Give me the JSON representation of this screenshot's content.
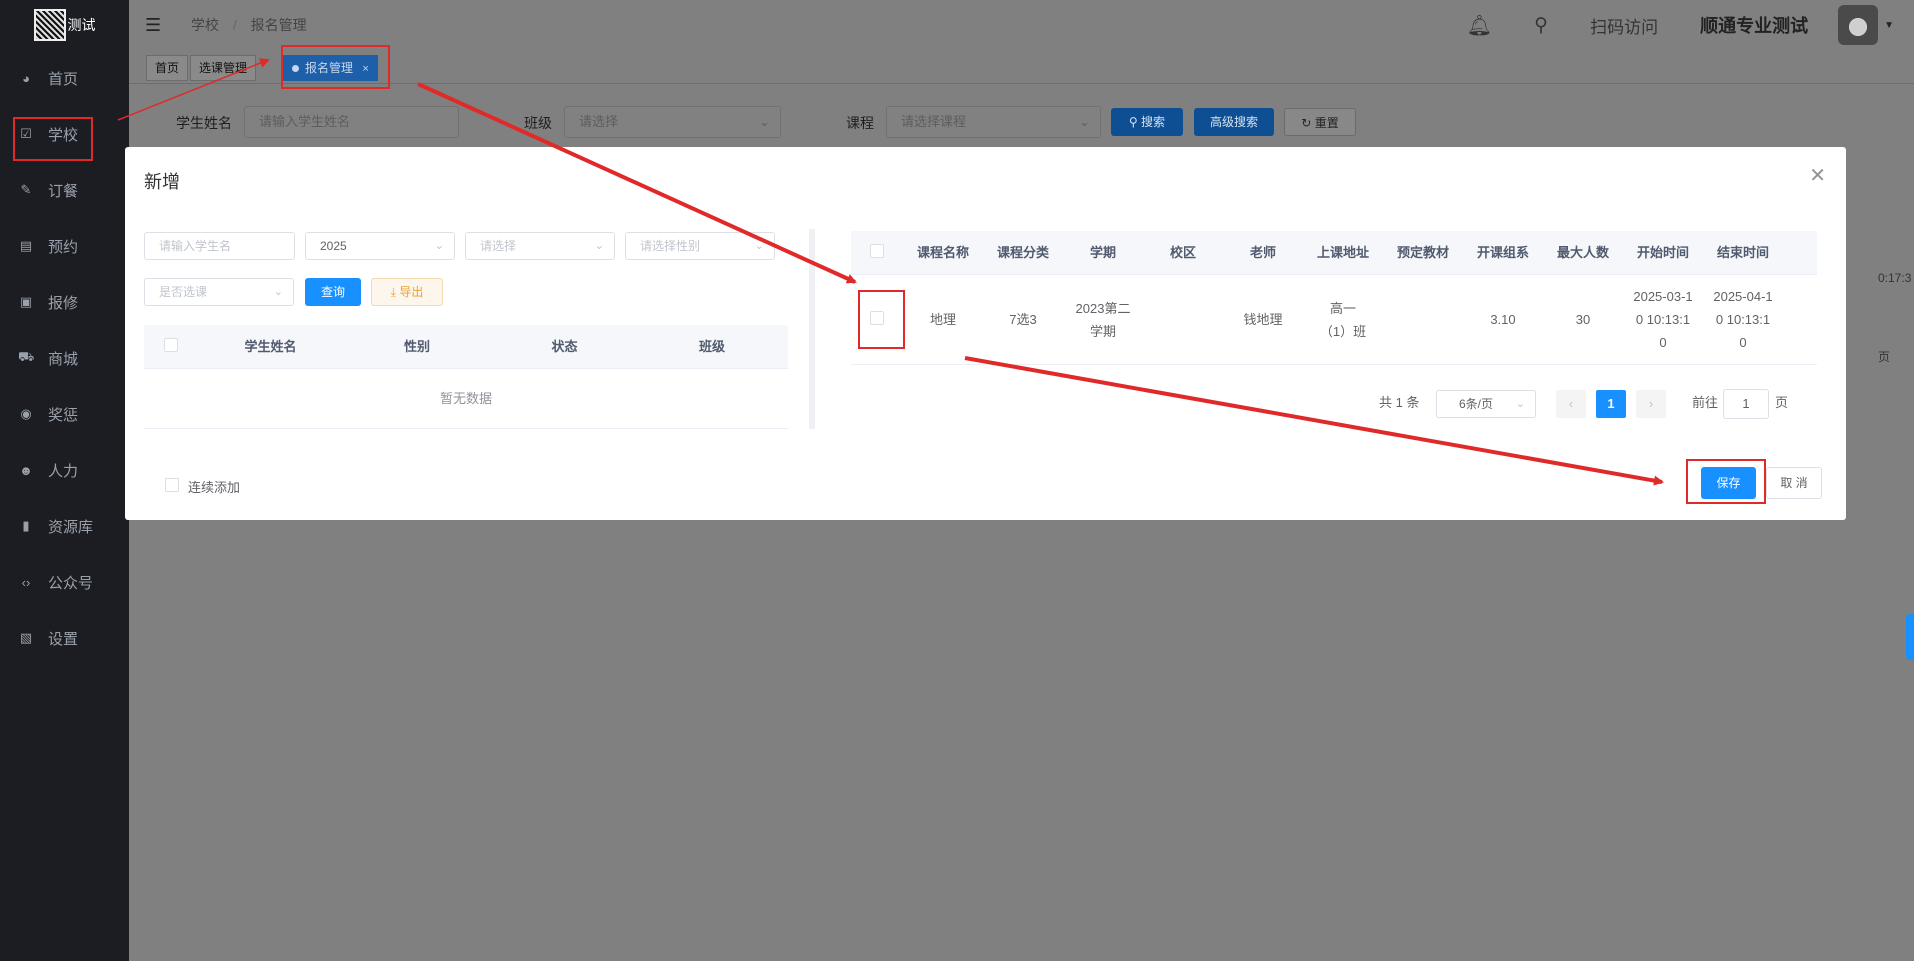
{
  "sidebar": {
    "logo_text": "测试",
    "items": [
      {
        "label": "首页",
        "icon": "dashboard-icon"
      },
      {
        "label": "学校",
        "icon": "checkbox-icon"
      },
      {
        "label": "订餐",
        "icon": "edit-icon"
      },
      {
        "label": "预约",
        "icon": "calendar-icon"
      },
      {
        "label": "报修",
        "icon": "toolbox-icon"
      },
      {
        "label": "商城",
        "icon": "cart-icon"
      },
      {
        "label": "奖惩",
        "icon": "eye-icon"
      },
      {
        "label": "人力",
        "icon": "user-icon"
      },
      {
        "label": "资源库",
        "icon": "bar-chart-icon"
      },
      {
        "label": "公众号",
        "icon": "code-icon"
      },
      {
        "label": "设置",
        "icon": "settings-icon"
      }
    ]
  },
  "topbar": {
    "breadcrumb": [
      "学校",
      "报名管理"
    ],
    "scan_label": "扫码访问",
    "user_name": "顺通专业测试"
  },
  "tags": [
    "首页",
    "选课管理",
    "报名管理"
  ],
  "tag_close": "×",
  "search": {
    "student_label": "学生姓名",
    "student_placeholder": "请输入学生姓名",
    "class_label": "班级",
    "class_placeholder": "请选择",
    "course_label": "课程",
    "course_placeholder": "请选择课程",
    "search_btn": "搜索",
    "advanced_btn": "高级搜索",
    "reset_btn": "重置",
    "frag_time": "0:17:3",
    "frag_page": "页"
  },
  "modal": {
    "title": "新增",
    "left": {
      "student_placeholder": "请输入学生名",
      "year_value": "2025",
      "select_placeholder": "请选择",
      "gender_placeholder": "请选择性别",
      "elective_placeholder": "是否选课",
      "query_btn": "查询",
      "export_btn": "导出",
      "columns": [
        "学生姓名",
        "性别",
        "状态",
        "班级"
      ],
      "empty_text": "暂无数据"
    },
    "right": {
      "columns": [
        "课程名称",
        "课程分类",
        "学期",
        "校区",
        "老师",
        "上课地址",
        "预定教材",
        "开课组系",
        "最大人数",
        "开始时间",
        "结束时间"
      ],
      "rows": [
        {
          "course_name": "地理",
          "category": "7选3",
          "term": "2023第二学期",
          "campus": "",
          "teacher": "钱地理",
          "address": "高一（1）班",
          "textbook": "",
          "group": "3.10",
          "max_people": "30",
          "start_time": "2025-03-10 10:13:10",
          "end_time": "2025-04-10 10:13:10"
        }
      ],
      "pagination": {
        "total_text": "共 1 条",
        "page_size": "6条/页",
        "current_page": "1",
        "goto_label": "前往",
        "goto_value": "1",
        "page_suffix": "页"
      }
    },
    "continuous_add_label": "连续添加",
    "save_btn": "保存",
    "cancel_btn": "取 消"
  },
  "colors": {
    "primary": "#1890ff",
    "annotation_red": "#e02a2a",
    "sidebar_bg": "#1b1d23"
  }
}
